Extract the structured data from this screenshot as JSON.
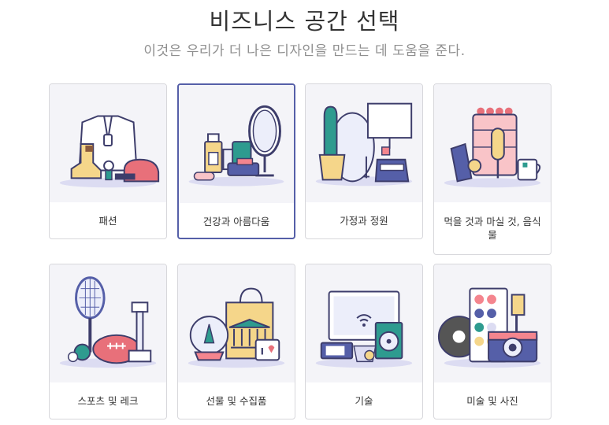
{
  "header": {
    "title": "비즈니스 공간 선택",
    "subtitle": "이것은 우리가 더 나은 디자인을 만드는 데 도움을 준다."
  },
  "categories": [
    {
      "label": "패션",
      "icon": "fashion-illustration",
      "selected": false
    },
    {
      "label": "건강과 아름다움",
      "icon": "health-beauty-illustration",
      "selected": true
    },
    {
      "label": "가정과 정원",
      "icon": "home-garden-illustration",
      "selected": false
    },
    {
      "label": "먹을 것과 마실 것, 음식물",
      "icon": "food-drink-illustration",
      "selected": false
    },
    {
      "label": "스포츠 및 레크",
      "icon": "sports-illustration",
      "selected": false
    },
    {
      "label": "선물 및 수집품",
      "icon": "gifts-illustration",
      "selected": false
    },
    {
      "label": "기술",
      "icon": "technology-illustration",
      "selected": false
    },
    {
      "label": "미술 및 사진",
      "icon": "art-photo-illustration",
      "selected": false
    }
  ],
  "colors": {
    "accent": "#555fa8",
    "outline": "#3d3d6b",
    "pink": "#f4858e",
    "teal": "#2e9b8f",
    "yellow": "#f5d68a",
    "lavender": "#dcdcf2"
  }
}
